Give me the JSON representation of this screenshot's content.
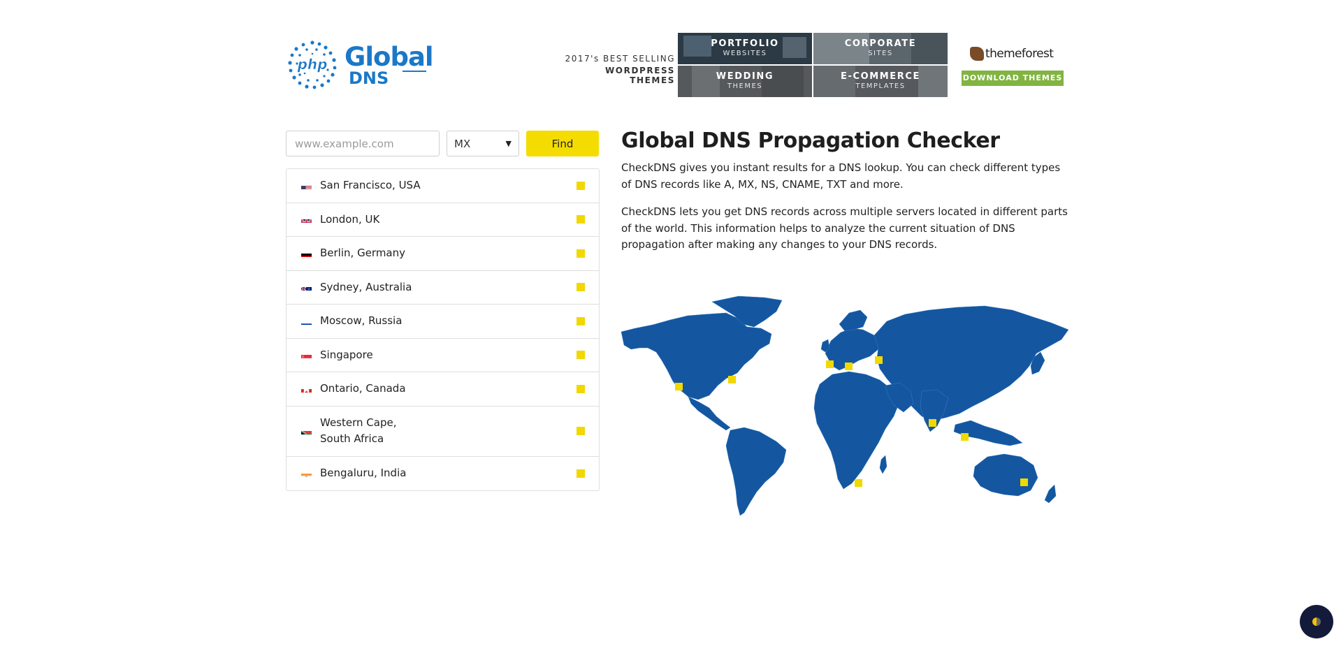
{
  "header": {
    "logo": {
      "word1": "Global",
      "word2": "DNS",
      "badge": "php"
    },
    "ad": {
      "tagline_1": "2017's BEST SELLING",
      "tagline_2": "WORDPRESS THEMES",
      "tiles": [
        {
          "title": "PORTFOLIO",
          "sub": "WEBSITES"
        },
        {
          "title": "CORPORATE",
          "sub": "SITES"
        },
        {
          "title": "WEDDING",
          "sub": "THEMES"
        },
        {
          "title": "E-COMMERCE",
          "sub": "TEMPLATES"
        }
      ],
      "brand": "themeforest",
      "cta": "DOWNLOAD THEMES"
    }
  },
  "search": {
    "placeholder": "www.example.com",
    "record_type": "MX",
    "find_label": "Find"
  },
  "servers": [
    {
      "name": "San Francisco, USA",
      "flag": "us"
    },
    {
      "name": "London, UK",
      "flag": "gb"
    },
    {
      "name": "Berlin, Germany",
      "flag": "de"
    },
    {
      "name": "Sydney, Australia",
      "flag": "au"
    },
    {
      "name": "Moscow, Russia",
      "flag": "ru"
    },
    {
      "name": "Singapore",
      "flag": "sg"
    },
    {
      "name": "Ontario, Canada",
      "flag": "ca"
    },
    {
      "name": "Western Cape, South Africa",
      "line1": "Western Cape,",
      "line2": "South Africa",
      "flag": "za"
    },
    {
      "name": "Bengaluru, India",
      "flag": "in"
    }
  ],
  "content": {
    "title": "Global DNS Propagation Checker",
    "para1": "CheckDNS gives you instant results for a DNS lookup. You can check different types of DNS records like A, MX, NS, CNAME, TXT and more.",
    "para2": "CheckDNS lets you get DNS records across multiple servers located in different parts of the world. This information helps to analyze the current situation of DNS propagation after making any changes to your DNS records."
  },
  "colors": {
    "brand_blue": "#1b78c8",
    "map_blue": "#1457a0",
    "marker_yellow": "#f0d800",
    "find_yellow": "#f5dc00",
    "cta_green": "#81b441"
  }
}
